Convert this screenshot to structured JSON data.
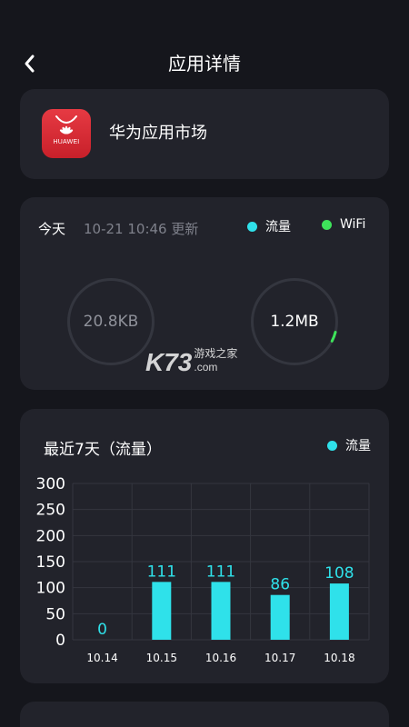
{
  "header": {
    "title": "应用详情"
  },
  "app": {
    "name": "华为应用市场",
    "icon_brand": "HUAWEI"
  },
  "today": {
    "label": "今天",
    "updated": "10-21 10:46 更新",
    "legend_flow": "流量",
    "legend_wifi": "WiFi",
    "flow_value": "20.8KB",
    "wifi_value": "1.2MB",
    "wifi_ring_fraction": 0.06
  },
  "watermark": {
    "brand": "K73",
    "cn": "游戏之家",
    "domain": ".com"
  },
  "colors": {
    "flow": "#2fe1ea",
    "wifi": "#3ee35a",
    "background": "#15161c",
    "card": "#22232b"
  },
  "week": {
    "title": "最近7天（流量）",
    "legend": "流量"
  },
  "chart_data": {
    "type": "bar",
    "title": "最近7天（流量）",
    "categories": [
      "10.14",
      "10.15",
      "10.16",
      "10.17",
      "10.18"
    ],
    "series": [
      {
        "name": "流量",
        "values": [
          0,
          111,
          111,
          86,
          108
        ]
      }
    ],
    "ylim": [
      0,
      300
    ],
    "yticks": [
      0,
      50,
      100,
      150,
      200,
      250,
      300
    ],
    "grid": true,
    "legend": "top-right"
  }
}
